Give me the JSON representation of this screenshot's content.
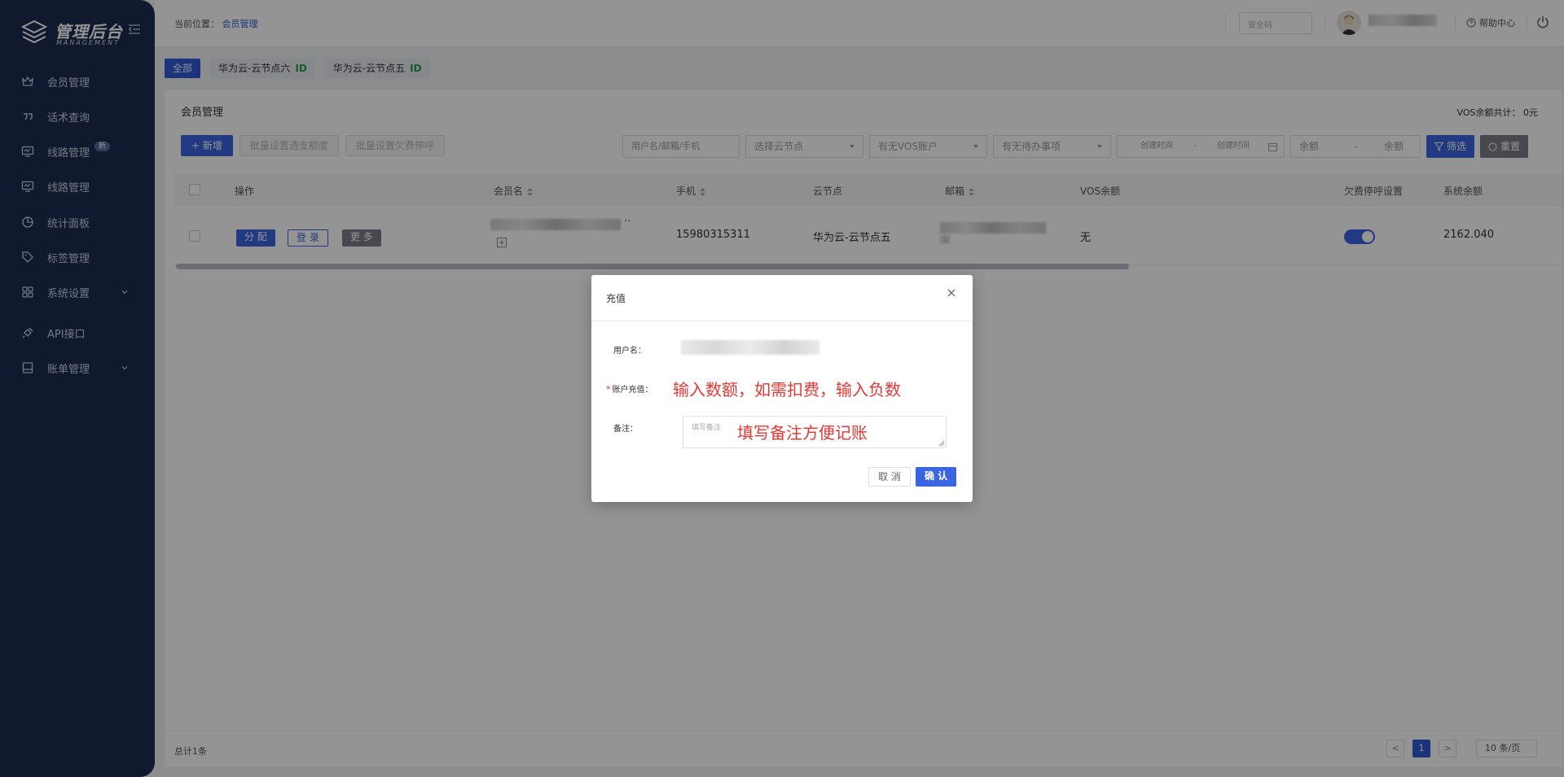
{
  "logo": {
    "title": "管理后台",
    "subtitle": "MANAGEMENT"
  },
  "sidebar": {
    "items": [
      {
        "label": "会员管理",
        "icon": "crown-icon"
      },
      {
        "label": "话术查询",
        "icon": "quote-icon"
      },
      {
        "label": "线路管理",
        "icon": "monitor-icon",
        "badge": "新"
      },
      {
        "label": "线路管理",
        "icon": "monitor-icon"
      },
      {
        "label": "统计面板",
        "icon": "pie-chart-icon"
      },
      {
        "label": "标签管理",
        "icon": "tag-icon"
      },
      {
        "label": "系统设置",
        "icon": "grid-icon"
      },
      {
        "label": "API接口",
        "icon": "plug-icon"
      },
      {
        "label": "账单管理",
        "icon": "ledger-icon"
      }
    ]
  },
  "header": {
    "breadcrumb_prefix": "当前位置：",
    "breadcrumb_current": "会员管理",
    "safe_code_placeholder": "安全码",
    "help_label": "帮助中心"
  },
  "node_tabs": [
    {
      "label": "全部",
      "active": true,
      "id_badge": ""
    },
    {
      "label": "华为云-云节点六",
      "active": false,
      "id_badge": "ID"
    },
    {
      "label": "华为云-云节点五",
      "active": false,
      "id_badge": "ID"
    }
  ],
  "card": {
    "title": "会员管理",
    "vos_total": "VOS余额共计： 0元"
  },
  "toolbar": {
    "add_label": "+ 新增",
    "batch_overdraft_label": "批量设置透支额度",
    "batch_stop_label": "批量设置欠费停呼"
  },
  "filters": {
    "search_placeholder": "用户名/邮箱/手机",
    "cloud_node_placeholder": "选择云节点",
    "vos_account_placeholder": "有无VOS账户",
    "todo_placeholder": "有无待办事项",
    "created_start": "创建时间",
    "range_sep": "-",
    "created_end": "创建时间",
    "balance_min": "余额",
    "balance_max": "余额",
    "filter_label": "筛选",
    "reset_label": "重置"
  },
  "table": {
    "columns": [
      "操作",
      "会员名",
      "手机",
      "云节点",
      "邮箱",
      "VOS余额",
      "欠费停呼设置",
      "系统余额"
    ],
    "rows": [
      {
        "ops": [
          "分 配",
          "登 录",
          "更 多"
        ],
        "member_suffix": "..",
        "phone": "15980315311",
        "cloud_node": "华为云-云节点五",
        "vos_balance": "无",
        "stop_on_arrears": true,
        "system_balance": "2162.040"
      }
    ]
  },
  "footer": {
    "total": "总计1条",
    "page_prev": "<",
    "page_current": "1",
    "page_next": ">",
    "page_size": "10 条/页"
  },
  "modal": {
    "title": "充值",
    "username_label": "用户名：",
    "amount_label": "账户充值：",
    "amount_required_mark": "*",
    "amount_value": "输入数额，如需扣费，输入负数",
    "note_label": "备注：",
    "note_placeholder": "填写备注",
    "note_hint": "填写备注方便记账",
    "cancel_label": "取 消",
    "confirm_label": "确 认"
  },
  "colors": {
    "sidebar_bg": "#1c2b4f",
    "primary": "#3a64e0",
    "tab_active": "#2f5bd6",
    "id_badge": "#1ea24a",
    "annotation_red": "#e53935"
  }
}
